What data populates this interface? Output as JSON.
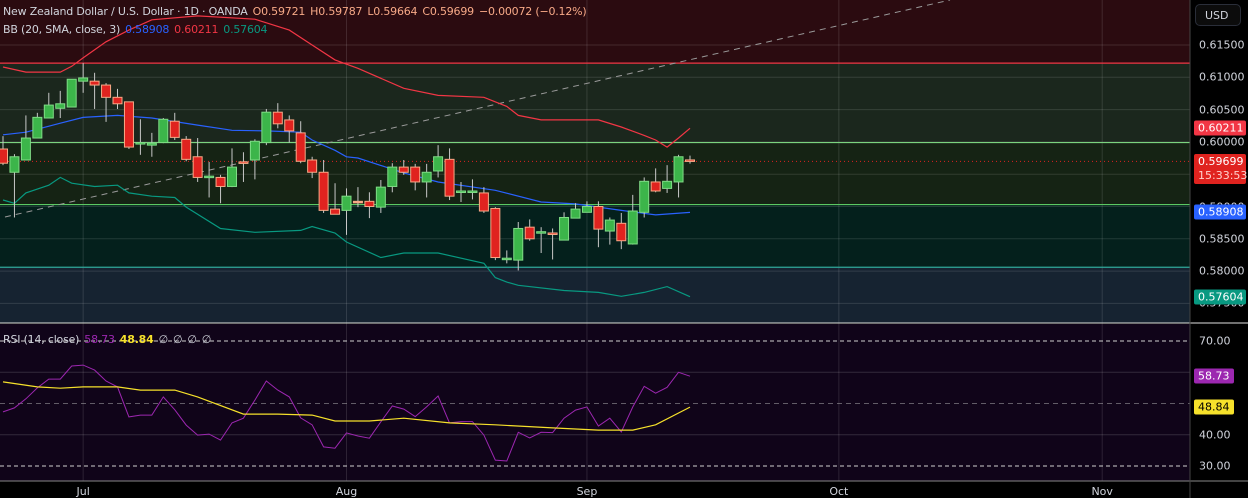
{
  "header": {
    "symbol": "New Zealand Dollar / U.S. Dollar · 1D · OANDA",
    "open": "O0.59721",
    "high": "H0.59787",
    "low": "L0.59664",
    "close": "C0.59699",
    "change": "−0.00072 (−0.12%)"
  },
  "bb_legend": {
    "label": "BB (20, SMA, close, 3)",
    "basis": "0.58908",
    "upper": "0.60211",
    "lower": "0.57604"
  },
  "rsi_legend": {
    "label": "RSI (14, close)",
    "rsi": "58.73",
    "ma": "48.84",
    "extras": [
      "∅",
      "∅",
      "∅",
      "∅"
    ]
  },
  "currency_button": "USD",
  "price_axis": {
    "ticks": [
      "0.61500",
      "0.61000",
      "0.60500",
      "0.60000",
      "0.59500",
      "0.59000",
      "0.58500",
      "0.58000",
      "0.57500"
    ],
    "tick_values": [
      0.615,
      0.61,
      0.605,
      0.6,
      0.595,
      0.59,
      0.585,
      0.58,
      0.575
    ],
    "upper_badge": "0.60211",
    "price_badge": "0.59699",
    "countdown": "15:33:53",
    "basis_badge": "0.58908",
    "lower_badge": "0.57604"
  },
  "rsi_axis": {
    "ticks": [
      "70.00",
      "40.00",
      "30.00"
    ],
    "tick_values": [
      70,
      40,
      30
    ],
    "rsi_badge": "58.73",
    "ma_badge": "48.84"
  },
  "time_axis": {
    "labels": [
      "Jul",
      "Aug",
      "Sep",
      "Oct",
      "Nov"
    ]
  },
  "colors": {
    "up": "#3cb54a",
    "down": "#e0231f",
    "doji": "#f7a987",
    "basis": "#2962ff",
    "upper": "#f23645",
    "lower": "#089981",
    "rsi": "#9c27b0",
    "rsi_ma": "#f6e12b"
  },
  "chart_data": {
    "type": "candlestick",
    "price_range": [
      0.5735,
      0.622
    ],
    "candles": [
      [
        0.5989,
        0.6009,
        0.5964,
        0.5967
      ],
      [
        0.5953,
        0.5981,
        0.5883,
        0.5977
      ],
      [
        0.5972,
        0.6041,
        0.5972,
        0.6006
      ],
      [
        0.6006,
        0.6045,
        0.6006,
        0.6038
      ],
      [
        0.6037,
        0.6076,
        0.6037,
        0.6057
      ],
      [
        0.6052,
        0.6079,
        0.6037,
        0.6059
      ],
      [
        0.6054,
        0.6097,
        0.6054,
        0.6097
      ],
      [
        0.6094,
        0.6122,
        0.6076,
        0.6099
      ],
      [
        0.6094,
        0.6107,
        0.6051,
        0.6088
      ],
      [
        0.6088,
        0.6091,
        0.6031,
        0.6069
      ],
      [
        0.6069,
        0.6082,
        0.6051,
        0.6059
      ],
      [
        0.6062,
        0.6062,
        0.5989,
        0.5992
      ],
      [
        0.5998,
        0.6035,
        0.598,
        0.5999
      ],
      [
        0.5995,
        0.6014,
        0.5977,
        0.5998
      ],
      [
        0.5999,
        0.6037,
        0.5998,
        0.6035
      ],
      [
        0.6032,
        0.6045,
        0.6003,
        0.6007
      ],
      [
        0.6004,
        0.6009,
        0.597,
        0.5973
      ],
      [
        0.5977,
        0.6006,
        0.5938,
        0.5945
      ],
      [
        0.5945,
        0.5969,
        0.5914,
        0.5947
      ],
      [
        0.5945,
        0.5949,
        0.5905,
        0.5931
      ],
      [
        0.5931,
        0.599,
        0.593,
        0.5961
      ],
      [
        0.5969,
        0.5984,
        0.5938,
        0.5967
      ],
      [
        0.5972,
        0.6004,
        0.5942,
        0.6001
      ],
      [
        0.5999,
        0.6051,
        0.5995,
        0.6046
      ],
      [
        0.6046,
        0.606,
        0.6021,
        0.6028
      ],
      [
        0.6034,
        0.6041,
        0.5999,
        0.6017
      ],
      [
        0.6014,
        0.6032,
        0.5967,
        0.597
      ],
      [
        0.5972,
        0.5977,
        0.5944,
        0.5953
      ],
      [
        0.5953,
        0.5972,
        0.589,
        0.5894
      ],
      [
        0.5896,
        0.5936,
        0.5888,
        0.5888
      ],
      [
        0.5894,
        0.5928,
        0.5856,
        0.5916
      ],
      [
        0.5908,
        0.593,
        0.5899,
        0.5907
      ],
      [
        0.5908,
        0.5922,
        0.5882,
        0.59
      ],
      [
        0.5899,
        0.5941,
        0.589,
        0.593
      ],
      [
        0.5931,
        0.5967,
        0.5922,
        0.5961
      ],
      [
        0.5961,
        0.5972,
        0.5949,
        0.5953
      ],
      [
        0.5961,
        0.5966,
        0.5925,
        0.5938
      ],
      [
        0.5938,
        0.5966,
        0.5914,
        0.5953
      ],
      [
        0.5955,
        0.5995,
        0.5945,
        0.5977
      ],
      [
        0.5973,
        0.599,
        0.591,
        0.5916
      ],
      [
        0.5922,
        0.5938,
        0.5907,
        0.5924
      ],
      [
        0.5922,
        0.5942,
        0.5911,
        0.5924
      ],
      [
        0.5921,
        0.593,
        0.589,
        0.5893
      ],
      [
        0.5897,
        0.5899,
        0.5817,
        0.5821
      ],
      [
        0.5818,
        0.5832,
        0.5812,
        0.582
      ],
      [
        0.5817,
        0.5876,
        0.5801,
        0.5866
      ],
      [
        0.5868,
        0.588,
        0.5847,
        0.585
      ],
      [
        0.5859,
        0.5868,
        0.5828,
        0.5861
      ],
      [
        0.5859,
        0.5866,
        0.5818,
        0.5857
      ],
      [
        0.5848,
        0.5891,
        0.5848,
        0.5883
      ],
      [
        0.5882,
        0.5905,
        0.5882,
        0.5896
      ],
      [
        0.5891,
        0.5908,
        0.5891,
        0.59
      ],
      [
        0.59,
        0.5908,
        0.5837,
        0.5865
      ],
      [
        0.5862,
        0.5883,
        0.5841,
        0.5879
      ],
      [
        0.5874,
        0.589,
        0.5834,
        0.5847
      ],
      [
        0.5842,
        0.5918,
        0.5841,
        0.5893
      ],
      [
        0.5891,
        0.5945,
        0.5883,
        0.5939
      ],
      [
        0.5938,
        0.5959,
        0.5922,
        0.5924
      ],
      [
        0.5928,
        0.5964,
        0.5921,
        0.5939
      ],
      [
        0.5938,
        0.598,
        0.5914,
        0.5977
      ],
      [
        0.59721,
        0.59787,
        0.59664,
        0.59699
      ]
    ],
    "bb_upper": [
      [
        0,
        0.6116
      ],
      [
        2,
        0.6108
      ],
      [
        5,
        0.6108
      ],
      [
        6,
        0.6117
      ],
      [
        7,
        0.613
      ],
      [
        9,
        0.6155
      ],
      [
        11,
        0.6173
      ],
      [
        13,
        0.6189
      ],
      [
        17,
        0.6195
      ],
      [
        22,
        0.619
      ],
      [
        25,
        0.6173
      ],
      [
        27,
        0.615
      ],
      [
        29,
        0.6127
      ],
      [
        31,
        0.6114
      ],
      [
        35,
        0.6083
      ],
      [
        38,
        0.6072
      ],
      [
        42,
        0.6069
      ],
      [
        44,
        0.6055
      ],
      [
        45,
        0.6041
      ],
      [
        47,
        0.6034
      ],
      [
        52,
        0.6034
      ],
      [
        54,
        0.6023
      ],
      [
        56,
        0.601
      ],
      [
        57,
        0.6003
      ],
      [
        58,
        0.5992
      ],
      [
        59,
        0.6006
      ],
      [
        60,
        0.60211
      ]
    ],
    "bb_basis": [
      [
        0,
        0.6011
      ],
      [
        2,
        0.6015
      ],
      [
        5,
        0.6029
      ],
      [
        7,
        0.6038
      ],
      [
        10,
        0.6041
      ],
      [
        13,
        0.6037
      ],
      [
        17,
        0.6026
      ],
      [
        20,
        0.6018
      ],
      [
        23,
        0.6017
      ],
      [
        26,
        0.6015
      ],
      [
        27,
        0.6003
      ],
      [
        29,
        0.5987
      ],
      [
        30,
        0.5977
      ],
      [
        31,
        0.5975
      ],
      [
        35,
        0.5952
      ],
      [
        38,
        0.5938
      ],
      [
        43,
        0.5925
      ],
      [
        47,
        0.5907
      ],
      [
        50,
        0.5904
      ],
      [
        54,
        0.5894
      ],
      [
        57,
        0.5887
      ],
      [
        60,
        0.58908
      ]
    ],
    "bb_lower": [
      [
        0,
        0.591
      ],
      [
        1,
        0.5905
      ],
      [
        2,
        0.5921
      ],
      [
        4,
        0.5933
      ],
      [
        5,
        0.5945
      ],
      [
        6,
        0.5936
      ],
      [
        8,
        0.5931
      ],
      [
        10,
        0.5933
      ],
      [
        11,
        0.5921
      ],
      [
        13,
        0.5916
      ],
      [
        15,
        0.5914
      ],
      [
        16,
        0.5899
      ],
      [
        19,
        0.5866
      ],
      [
        22,
        0.586
      ],
      [
        26,
        0.5863
      ],
      [
        27,
        0.5869
      ],
      [
        29,
        0.5859
      ],
      [
        30,
        0.5845
      ],
      [
        33,
        0.5821
      ],
      [
        35,
        0.5828
      ],
      [
        38,
        0.5828
      ],
      [
        42,
        0.5812
      ],
      [
        43,
        0.579
      ],
      [
        44,
        0.5783
      ],
      [
        45,
        0.5778
      ],
      [
        49,
        0.577
      ],
      [
        52,
        0.5767
      ],
      [
        54,
        0.5761
      ],
      [
        56,
        0.5767
      ],
      [
        58,
        0.5776
      ],
      [
        60,
        0.57604
      ]
    ],
    "zones": [
      0.6122,
      0.5999,
      0.5903,
      0.5806
    ],
    "current_price": 0.59699,
    "rsi_range": [
      20,
      80
    ],
    "rsi": [
      47.3,
      48.6,
      51.5,
      55,
      57.8,
      57.8,
      62,
      62.3,
      60.7,
      57.2,
      55.3,
      45.7,
      46.3,
      46.3,
      52.1,
      48,
      43.1,
      39.9,
      40.2,
      38.3,
      43.8,
      45.3,
      51.1,
      57.2,
      54.3,
      52.1,
      45.4,
      43.2,
      36.1,
      35.7,
      40.6,
      39.6,
      38.9,
      44.1,
      49.2,
      48.2,
      45.8,
      48.9,
      52.4,
      43.8,
      44.2,
      44.2,
      39.9,
      31.9,
      31.6,
      40.8,
      39,
      40.8,
      40.7,
      45.3,
      47.9,
      48.9,
      42.8,
      45.3,
      40.9,
      48.9,
      55.5,
      53.3,
      55.2,
      60,
      58.73
    ],
    "rsi_ma": [
      [
        0,
        56.9
      ],
      [
        3,
        55.3
      ],
      [
        5,
        54.9
      ],
      [
        7,
        55.3
      ],
      [
        10,
        55.3
      ],
      [
        12,
        54.3
      ],
      [
        15,
        54.3
      ],
      [
        17,
        52.1
      ],
      [
        21,
        46.6
      ],
      [
        24,
        46.6
      ],
      [
        27,
        46.3
      ],
      [
        29,
        44.4
      ],
      [
        32,
        44.4
      ],
      [
        35,
        45.3
      ],
      [
        39,
        43.8
      ],
      [
        43,
        43.2
      ],
      [
        48,
        42.2
      ],
      [
        52,
        41.5
      ],
      [
        55,
        41.5
      ],
      [
        57,
        43.2
      ],
      [
        60,
        48.84
      ]
    ],
    "month_start_index": [
      7,
      30,
      51,
      73,
      96
    ]
  }
}
